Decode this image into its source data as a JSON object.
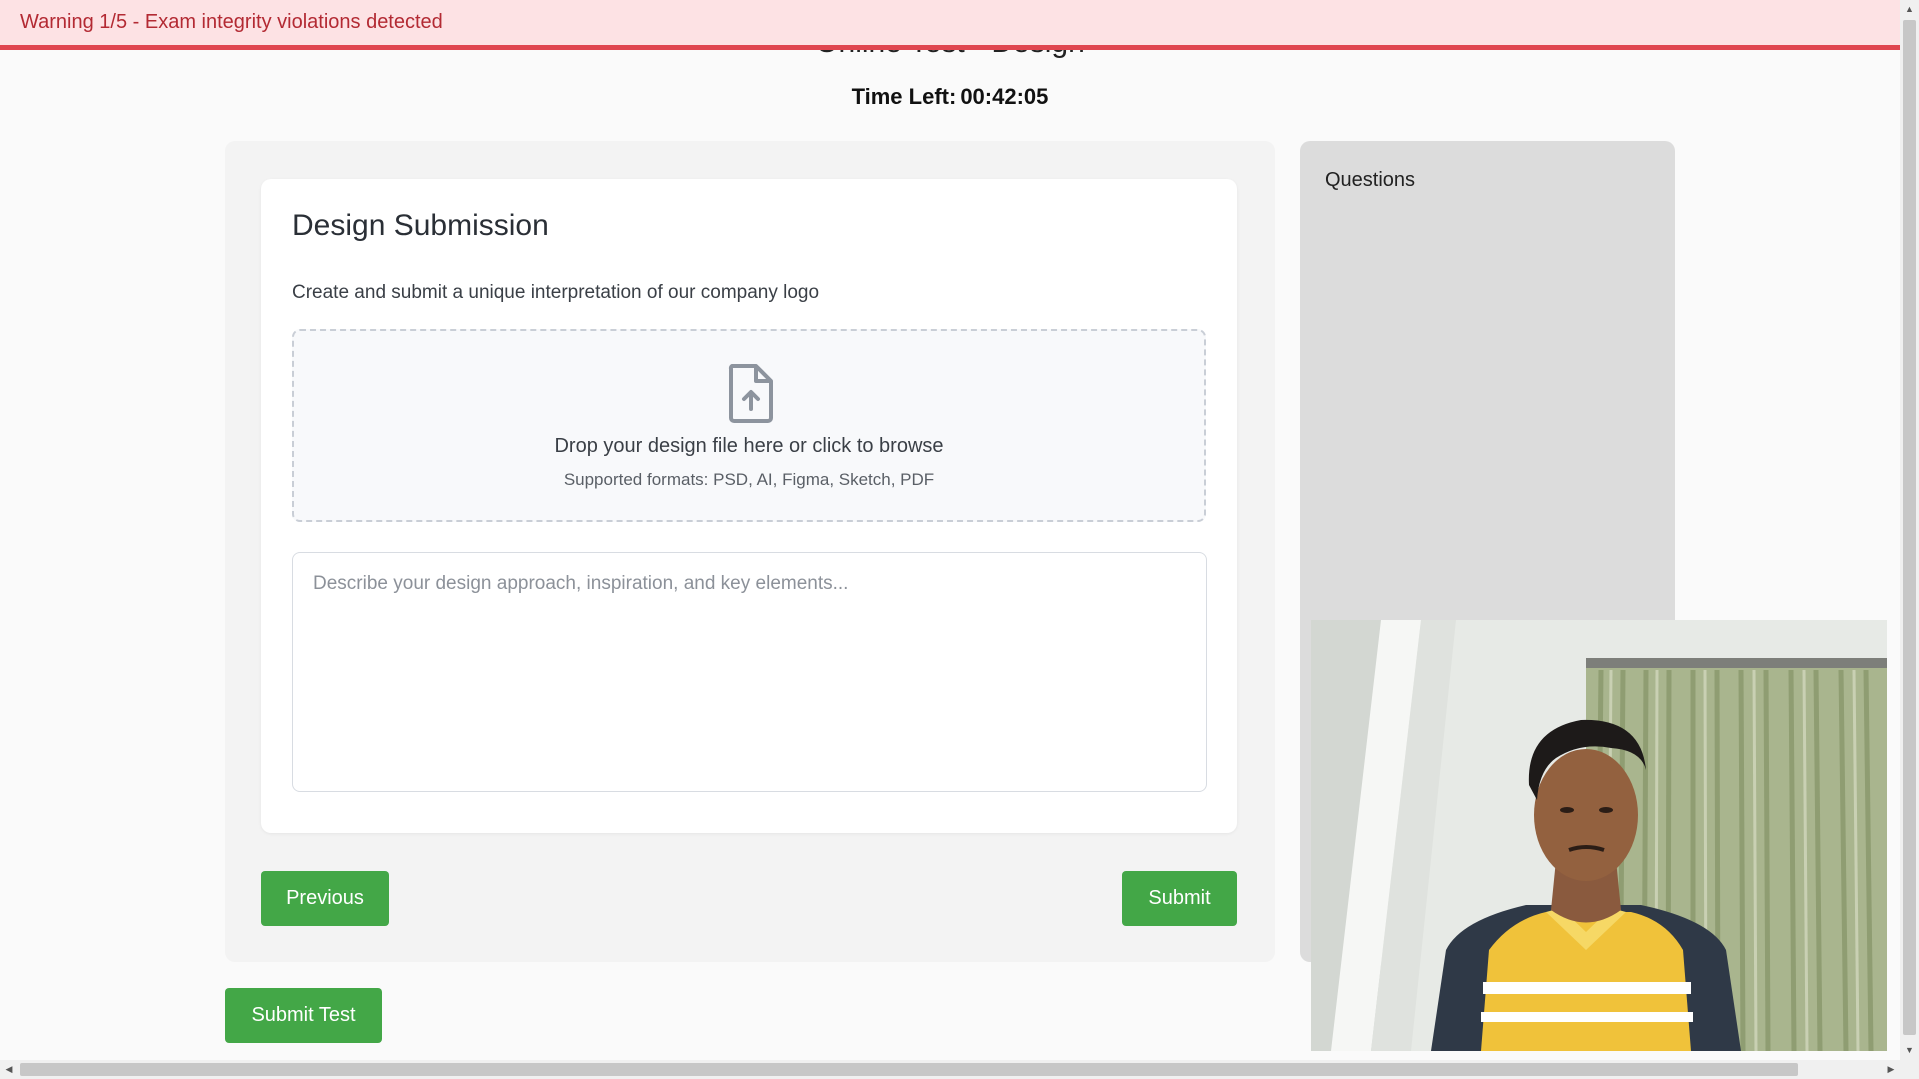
{
  "warning": {
    "text": "Warning 1/5 - Exam integrity violations detected"
  },
  "header": {
    "title": "Online Test - Design",
    "time_label": "Time Left:",
    "time_value": "00:42:05"
  },
  "question": {
    "title": "Design Submission",
    "prompt": "Create and submit a unique interpretation of our company logo",
    "upload": {
      "icon": "file-upload-icon",
      "main_text": "Drop your design file here or click to browse",
      "formats_text": "Supported formats: PSD, AI, Figma, Sketch, PDF"
    },
    "description": {
      "value": "",
      "placeholder": "Describe your design approach, inspiration, and key elements..."
    },
    "previous_label": "Previous",
    "submit_label": "Submit"
  },
  "sidebar": {
    "heading": "Questions"
  },
  "footer": {
    "submit_test_label": "Submit Test"
  },
  "colors": {
    "accent_green": "#43a747",
    "warning_bg": "#fde2e4",
    "warning_border": "#e0464f",
    "warning_text": "#b32a33"
  }
}
